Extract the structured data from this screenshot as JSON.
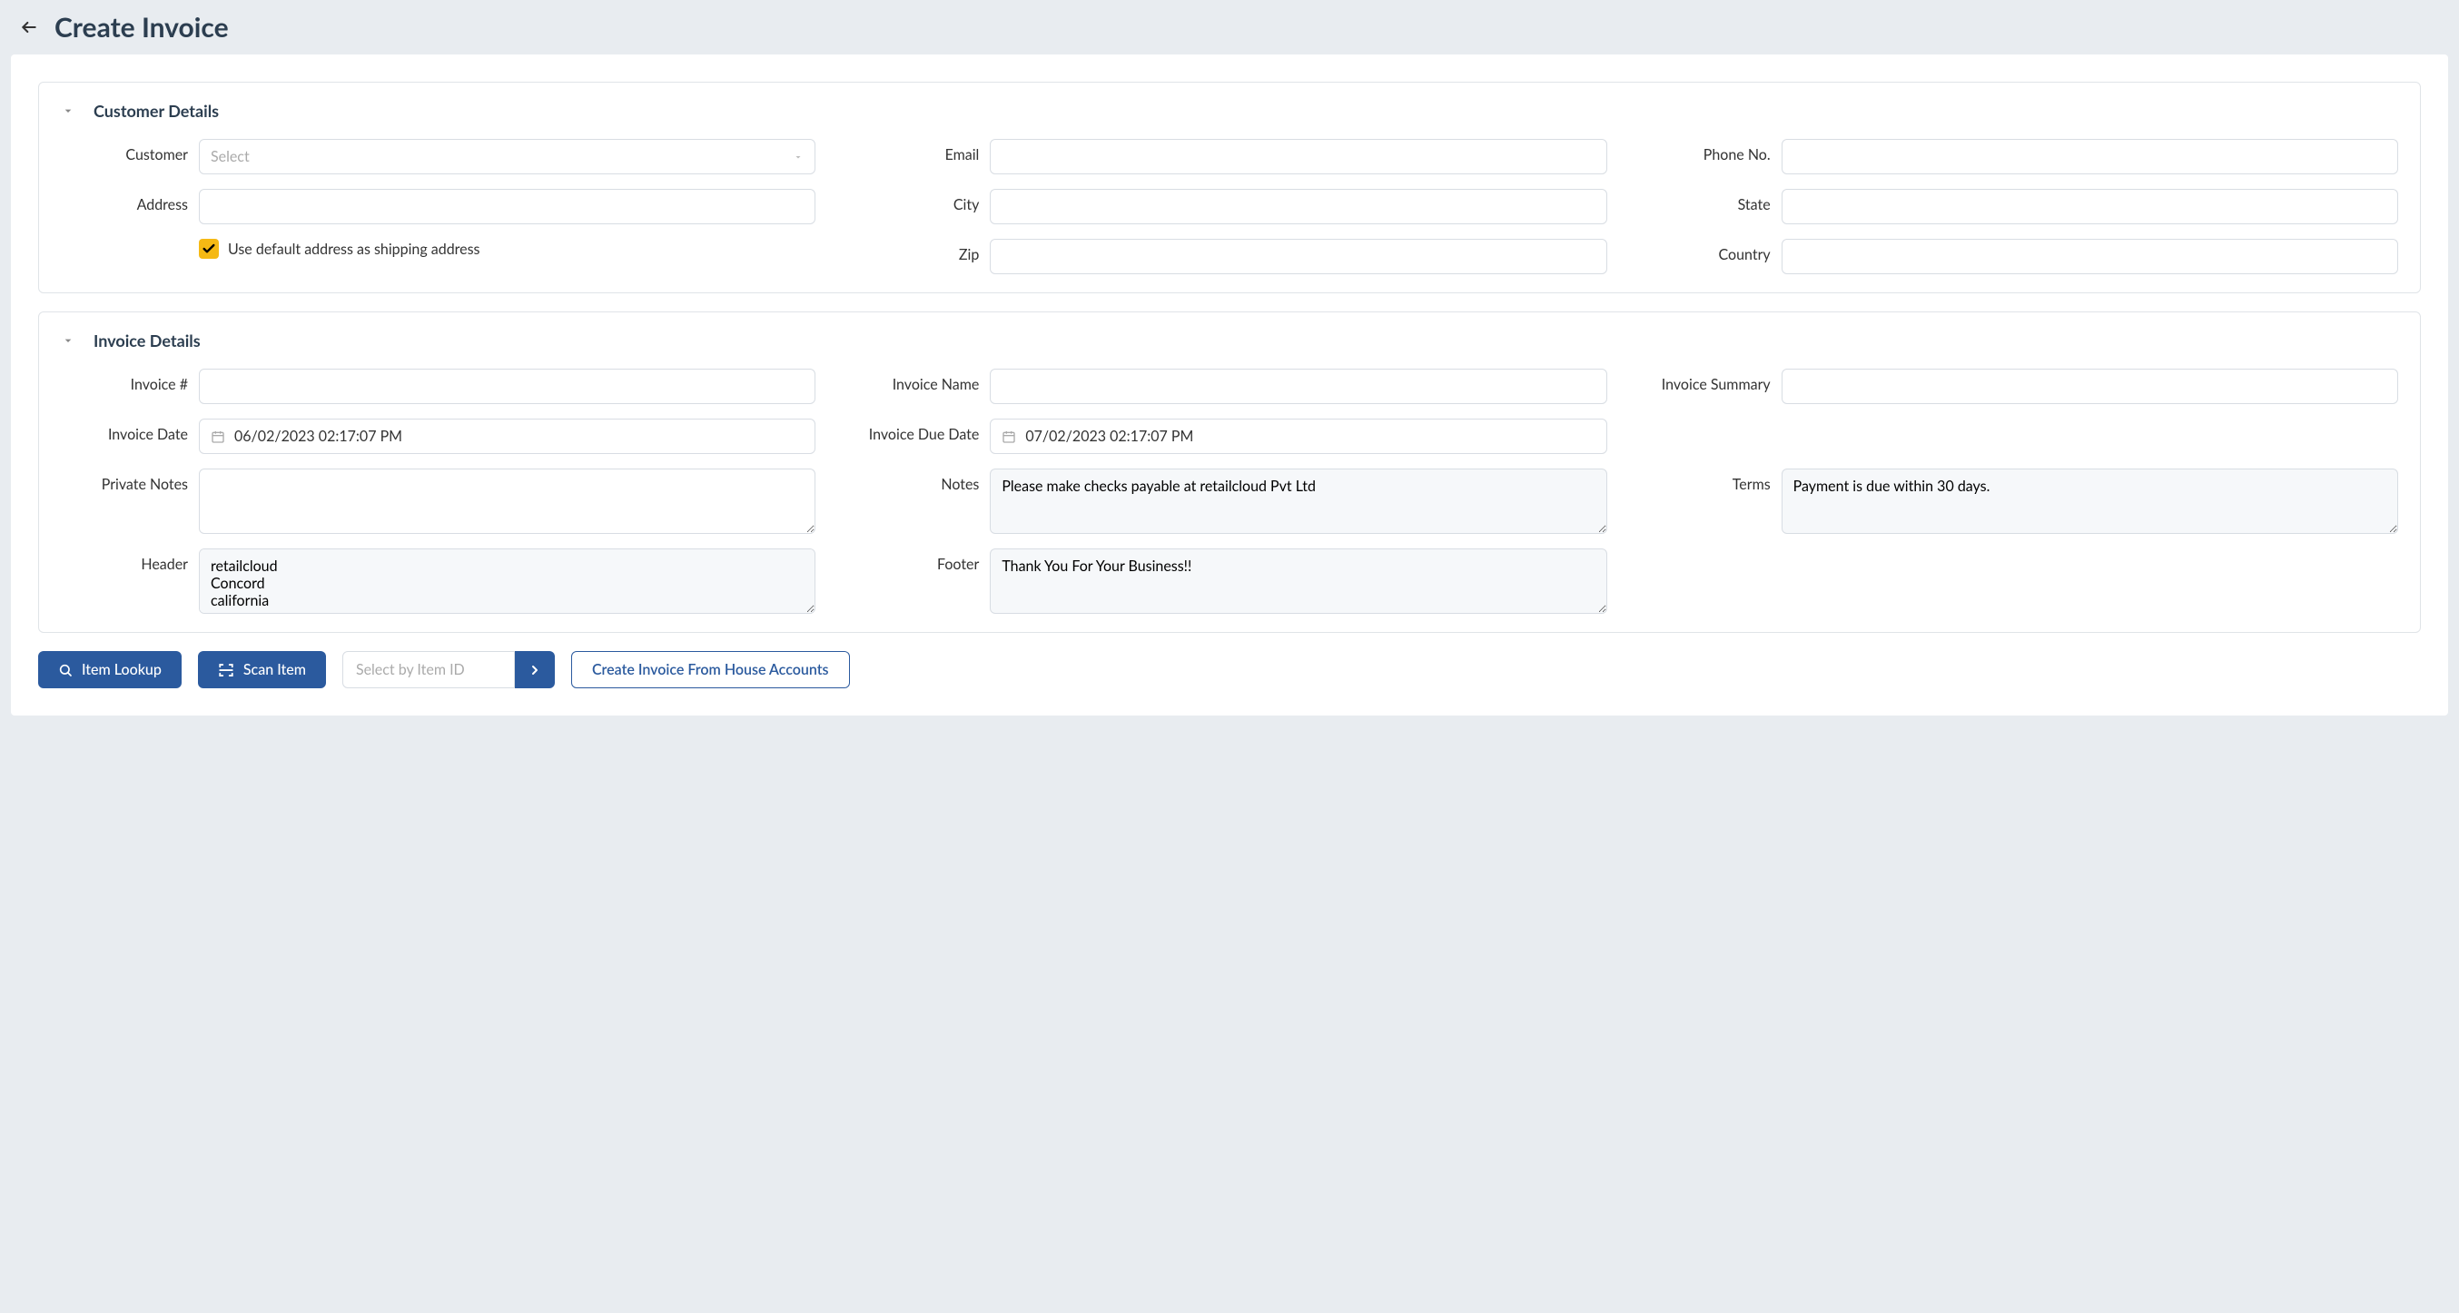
{
  "page": {
    "title": "Create Invoice"
  },
  "customer_details": {
    "section_title": "Customer Details",
    "customer_label": "Customer",
    "customer_placeholder": "Select",
    "customer_value": "",
    "email_label": "Email",
    "email_value": "",
    "phone_label": "Phone No.",
    "phone_value": "",
    "address_label": "Address",
    "address_value": "",
    "city_label": "City",
    "city_value": "",
    "state_label": "State",
    "state_value": "",
    "zip_label": "Zip",
    "zip_value": "",
    "country_label": "Country",
    "country_value": "",
    "default_address_checked": true,
    "default_address_label": "Use default address as shipping address"
  },
  "invoice_details": {
    "section_title": "Invoice Details",
    "invoice_number_label": "Invoice #",
    "invoice_number_value": "",
    "invoice_name_label": "Invoice Name",
    "invoice_name_value": "",
    "invoice_summary_label": "Invoice Summary",
    "invoice_summary_value": "",
    "invoice_date_label": "Invoice Date",
    "invoice_date_value": "06/02/2023 02:17:07 PM",
    "invoice_due_date_label": "Invoice Due Date",
    "invoice_due_date_value": "07/02/2023 02:17:07 PM",
    "private_notes_label": "Private Notes",
    "private_notes_value": "",
    "notes_label": "Notes",
    "notes_value": "Please make checks payable at retailcloud Pvt Ltd",
    "terms_label": "Terms",
    "terms_value": "Payment is due within 30 days.",
    "header_label": "Header",
    "header_value": "retailcloud\nConcord\ncalifornia",
    "footer_label": "Footer",
    "footer_value": "Thank You For Your Business!!"
  },
  "actions": {
    "item_lookup_label": "Item Lookup",
    "scan_item_label": "Scan Item",
    "item_id_placeholder": "Select by Item ID",
    "create_from_house_label": "Create Invoice From House Accounts"
  }
}
